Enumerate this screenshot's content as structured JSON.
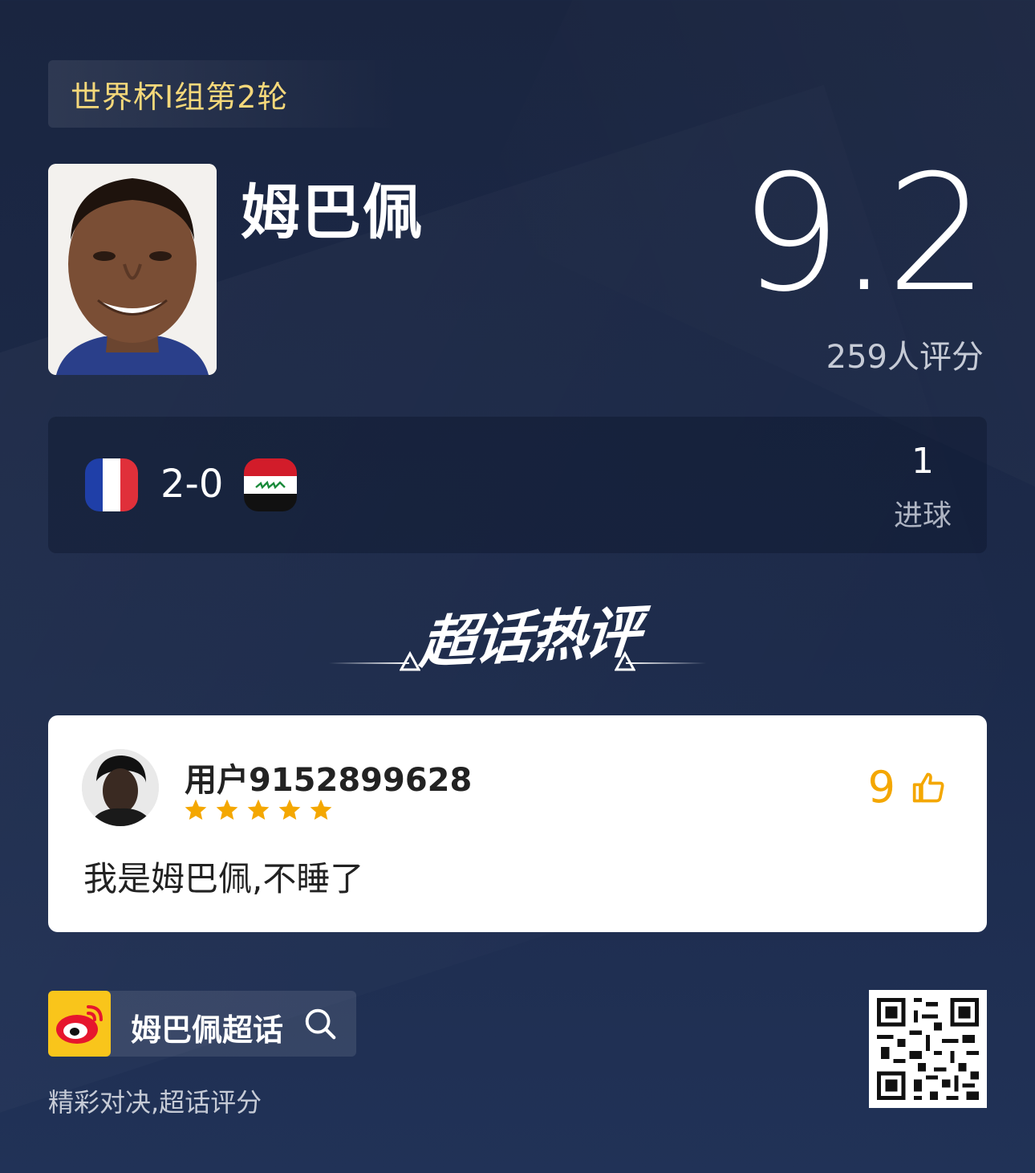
{
  "round_tag": "世界杯I组第2轮",
  "player": {
    "name": "姆巴佩"
  },
  "rating": {
    "score": "9.2",
    "raters": "259人评分"
  },
  "match": {
    "home_flag": "France",
    "away_flag": "Iraq",
    "score": "2-0",
    "stat_value": "1",
    "stat_label": "进球"
  },
  "section_title": "超话热评",
  "comment": {
    "username": "用户9152899628",
    "stars": 5,
    "likes": "9",
    "text": "我是姆巴佩,不睡了"
  },
  "footer": {
    "topic": "姆巴佩超话",
    "tagline": "精彩对决,超话评分"
  },
  "colors": {
    "accent_gold": "#f5d87a",
    "star": "#f4a700",
    "weibo_yellow": "#f9c51b"
  }
}
